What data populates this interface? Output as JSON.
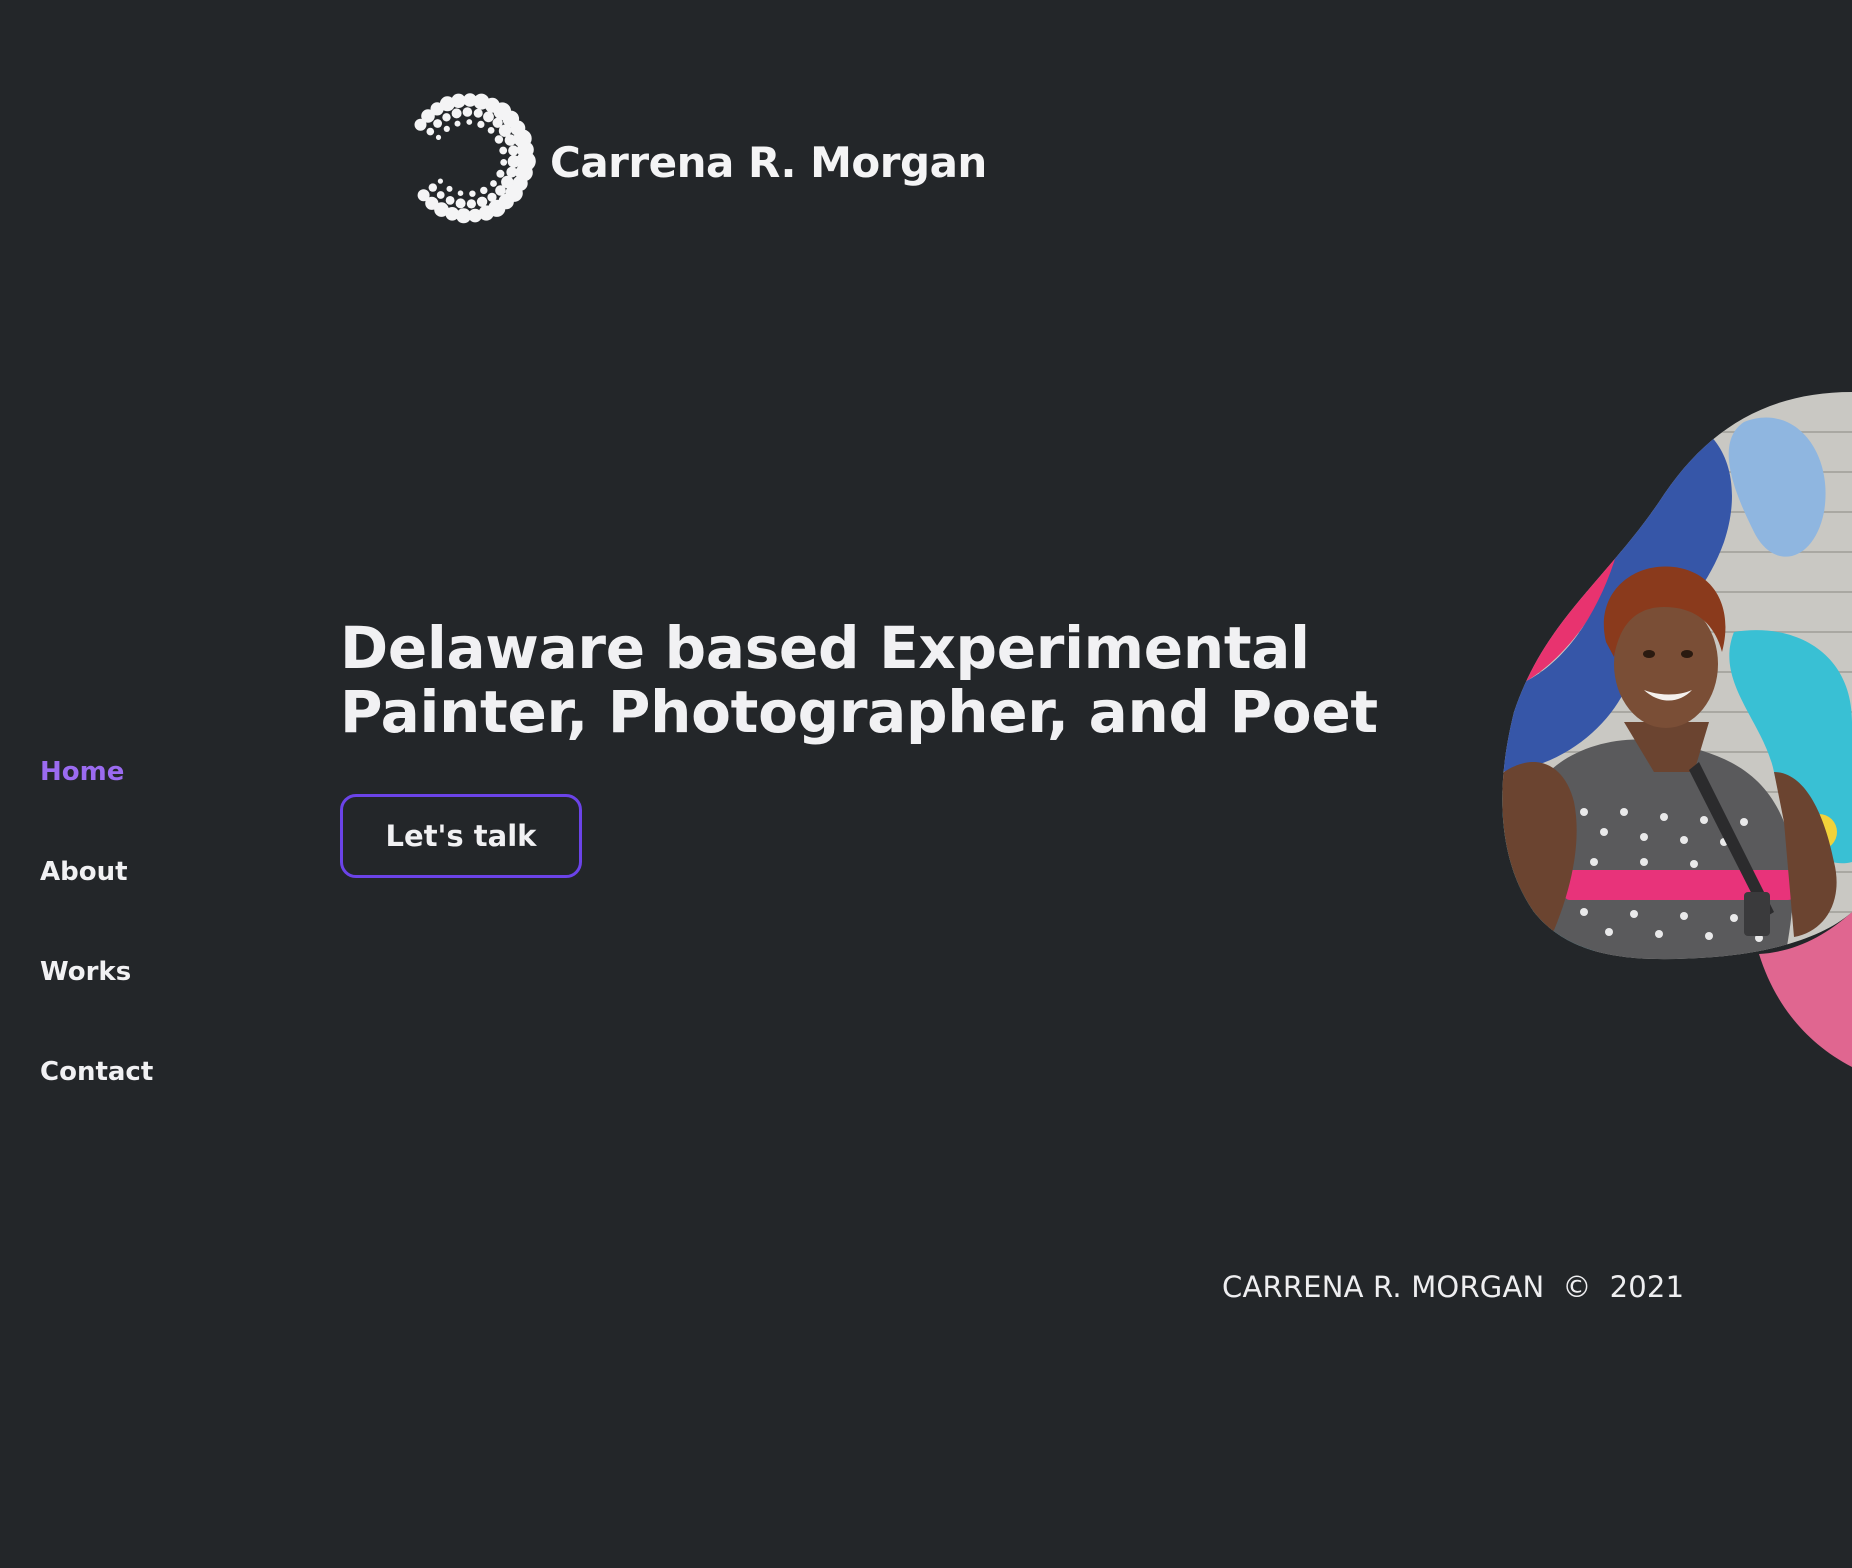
{
  "header": {
    "site_name": "Carrena R. Morgan",
    "logo_icon": "dotted-c-logo"
  },
  "nav": {
    "items": [
      {
        "label": "Home",
        "active": true
      },
      {
        "label": "About",
        "active": false
      },
      {
        "label": "Works",
        "active": false
      },
      {
        "label": "Contact",
        "active": false
      }
    ]
  },
  "hero": {
    "title_line1": "Delaware based Experimental",
    "title_line2": "Painter, Photographer, and Poet",
    "cta_label": "Let's talk"
  },
  "footer": {
    "owner": "CARRENA R. MORGAN",
    "copyright_symbol": "©",
    "year": "2021"
  },
  "colors": {
    "background": "#232629",
    "accent": "#9b6bf0",
    "button_border": "#6b43e8",
    "blob_pink": "#e06690"
  }
}
